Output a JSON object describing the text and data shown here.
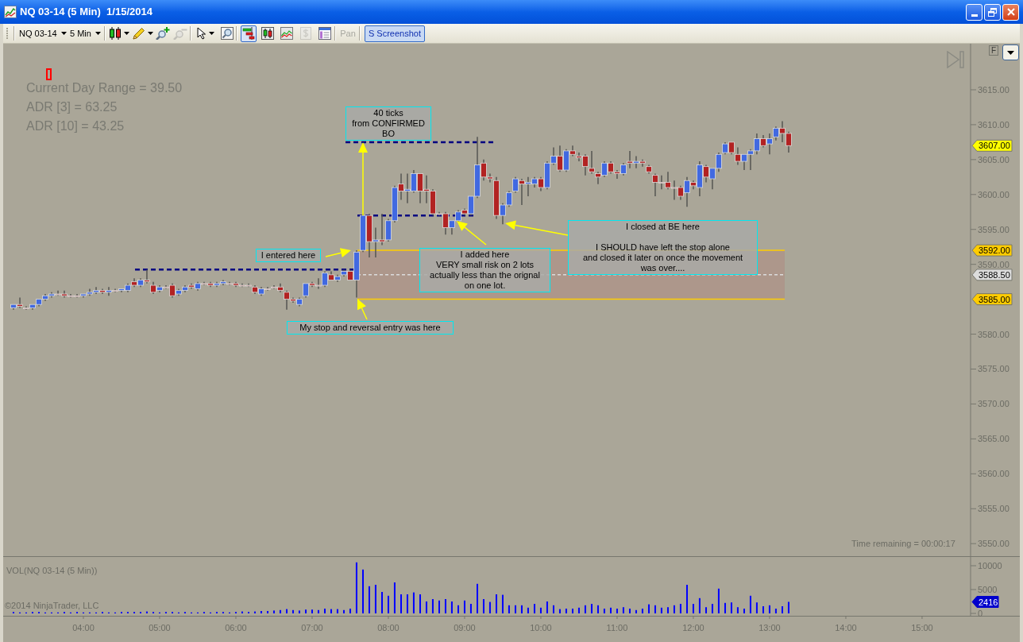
{
  "window": {
    "title": "NQ 03-14 (5 Min)  1/15/2014"
  },
  "toolbar": {
    "instrument": {
      "label": "NQ 03-14"
    },
    "interval": {
      "label": "5 Min"
    },
    "tools": [
      {
        "dropdown": true,
        "disabled": false
      },
      {
        "dropdown": true,
        "disabled": false
      },
      {
        "dropdown": false,
        "disabled": false
      },
      {
        "dropdown": false,
        "disabled": true
      },
      {
        "dropdown": true,
        "disabled": false
      },
      {
        "dropdown": false,
        "disabled": false
      }
    ],
    "toggles": [
      {
        "selected": true,
        "disabled": false
      },
      {
        "selected": false,
        "disabled": false
      },
      {
        "selected": false,
        "disabled": false
      },
      {
        "selected": false,
        "disabled": true
      },
      {
        "selected": false,
        "disabled": false
      }
    ],
    "pan": {
      "label": "Pan",
      "disabled": true
    },
    "screenshot": {
      "label": "S Screenshot",
      "selected": true
    }
  },
  "price_pane": {
    "indicator_lines": [
      "Current Day Range = 39.50",
      "ADR [3] = 63.25",
      "ADR [10] = 43.25"
    ],
    "f_button": {
      "label": "F"
    },
    "axis_tags": [
      {
        "label": "3607.00"
      },
      {
        "label": "3592.00"
      },
      {
        "label": "3588.50"
      },
      {
        "label": "3585.00"
      }
    ],
    "time_remaining": "Time remaining = 00:00:17",
    "chart_data": [
      {
        "type": "candlestick",
        "tick_labels": "y",
        "xlim": [
          2.948,
          16.282
        ],
        "ylim": [
          3548.2,
          3621.6
        ],
        "yticks": [
          {
            "value": 3550,
            "label": "3550.00"
          },
          {
            "value": 3555,
            "label": "3555.00"
          },
          {
            "value": 3560,
            "label": "3560.00"
          },
          {
            "value": 3565,
            "label": "3565.00"
          },
          {
            "value": 3570,
            "label": "3570.00"
          },
          {
            "value": 3575,
            "label": "3575.00"
          },
          {
            "value": 3580,
            "label": "3580.00"
          },
          {
            "value": 3590,
            "label": "3590.00"
          },
          {
            "value": 3595,
            "label": "3595.00"
          },
          {
            "value": 3600,
            "label": "3600.00"
          },
          {
            "value": 3605,
            "label": "3605.00"
          },
          {
            "value": 3610,
            "label": "3610.00"
          },
          {
            "value": 3615,
            "label": "3615.00"
          }
        ],
        "x": [
          3.083,
          3.167,
          3.25,
          3.333,
          3.417,
          3.5,
          3.583,
          3.667,
          3.75,
          3.833,
          3.917,
          4,
          4.083,
          4.167,
          4.25,
          4.333,
          4.417,
          4.5,
          4.583,
          4.667,
          4.75,
          4.833,
          4.917,
          5,
          5.083,
          5.167,
          5.25,
          5.333,
          5.417,
          5.5,
          5.583,
          5.667,
          5.75,
          5.833,
          5.917,
          6,
          6.083,
          6.167,
          6.25,
          6.333,
          6.417,
          6.5,
          6.583,
          6.667,
          6.75,
          6.833,
          6.917,
          7,
          7.083,
          7.167,
          7.25,
          7.333,
          7.417,
          7.5,
          7.583,
          7.667,
          7.75,
          7.833,
          7.917,
          8,
          8.083,
          8.167,
          8.25,
          8.333,
          8.417,
          8.5,
          8.583,
          8.667,
          8.75,
          8.833,
          8.917,
          9,
          9.083,
          9.167,
          9.25,
          9.333,
          9.417,
          9.5,
          9.583,
          9.667,
          9.75,
          9.833,
          9.917,
          10,
          10.083,
          10.167,
          10.25,
          10.333,
          10.417,
          10.5,
          10.583,
          10.667,
          10.75,
          10.833,
          10.917,
          11,
          11.083,
          11.167,
          11.25,
          11.333,
          11.417,
          11.5,
          11.583,
          11.667,
          11.75,
          11.833,
          11.917,
          12,
          12.083,
          12.167,
          12.25,
          12.333,
          12.417,
          12.5,
          12.583,
          12.667,
          12.75,
          12.833,
          12.917,
          13,
          13.083,
          13.167,
          13.25
        ],
        "ohlc": [
          [
            3583.75,
            3584.25,
            3583.5,
            3584.25
          ],
          [
            3584.25,
            3585.25,
            3583.75,
            3584
          ],
          [
            3583.75,
            3584,
            3583.5,
            3583.75
          ],
          [
            3583.75,
            3584.25,
            3583.5,
            3584.25
          ],
          [
            3584.25,
            3585,
            3584,
            3585
          ],
          [
            3585,
            3585.75,
            3584.75,
            3585.5
          ],
          [
            3585.5,
            3586,
            3585.25,
            3585.75
          ],
          [
            3585.75,
            3586.25,
            3585.5,
            3585.75
          ],
          [
            3585.75,
            3586.25,
            3585.25,
            3585.5
          ],
          [
            3585.5,
            3585.75,
            3585.25,
            3585.5
          ],
          [
            3585.5,
            3585.75,
            3585.25,
            3585.5
          ],
          [
            3585.5,
            3585.75,
            3585.25,
            3585.75
          ],
          [
            3585.75,
            3586.5,
            3585.5,
            3586
          ],
          [
            3586,
            3586.75,
            3585.75,
            3586.25
          ],
          [
            3586.25,
            3586.5,
            3585.75,
            3586
          ],
          [
            3586,
            3586.75,
            3585.5,
            3586.25
          ],
          [
            3586.25,
            3586.5,
            3586,
            3586.25
          ],
          [
            3586.25,
            3586.5,
            3586,
            3586.5
          ],
          [
            3586.25,
            3587.25,
            3586,
            3587
          ],
          [
            3587.5,
            3588,
            3586.75,
            3587
          ],
          [
            3587,
            3588,
            3586.75,
            3587.75
          ],
          [
            3587.75,
            3589.25,
            3587.25,
            3587.5
          ],
          [
            3587,
            3587.5,
            3585.75,
            3586
          ],
          [
            3586.25,
            3587,
            3586,
            3586.75
          ],
          [
            3586.75,
            3587,
            3586.5,
            3586.75
          ],
          [
            3587,
            3587.25,
            3585.25,
            3585.5
          ],
          [
            3585.75,
            3586.5,
            3585.5,
            3586.25
          ],
          [
            3586.25,
            3587,
            3586,
            3586.75
          ],
          [
            3587,
            3587.25,
            3586.5,
            3586.75
          ],
          [
            3586.5,
            3587.5,
            3586.25,
            3587.25
          ],
          [
            3587.25,
            3587.5,
            3587,
            3587.25
          ],
          [
            3587.25,
            3587.5,
            3586.75,
            3587
          ],
          [
            3587,
            3587.5,
            3586.75,
            3587.25
          ],
          [
            3587.25,
            3587.75,
            3587,
            3587.5
          ],
          [
            3587.25,
            3587.5,
            3587,
            3587.25
          ],
          [
            3587.25,
            3587.5,
            3586.75,
            3587
          ],
          [
            3587,
            3587.25,
            3586.75,
            3587
          ],
          [
            3587,
            3587.25,
            3586.75,
            3587
          ],
          [
            3586.75,
            3587,
            3585.75,
            3586
          ],
          [
            3585.75,
            3586.75,
            3585.5,
            3586.5
          ],
          [
            3586.5,
            3586.75,
            3586.25,
            3586.5
          ],
          [
            3586.75,
            3587,
            3586.5,
            3586.75
          ],
          [
            3586.75,
            3587.25,
            3586,
            3586.25
          ],
          [
            3586,
            3586.25,
            3583.5,
            3585
          ],
          [
            3585,
            3585.25,
            3584.5,
            3584.75
          ],
          [
            3584.25,
            3585.25,
            3584,
            3585
          ],
          [
            3585.5,
            3587.25,
            3585.25,
            3587.25
          ],
          [
            3587.25,
            3587.5,
            3586.75,
            3587
          ],
          [
            3587,
            3588,
            3586.5,
            3587
          ],
          [
            3587,
            3589,
            3586.75,
            3588.75
          ],
          [
            3588.5,
            3589,
            3587.75,
            3587.75
          ],
          [
            3587.75,
            3588.5,
            3587.5,
            3588.25
          ],
          [
            3588.5,
            3589.25,
            3588.25,
            3589
          ],
          [
            3589,
            3589.25,
            3587.75,
            3587.75
          ],
          [
            3587.75,
            3592,
            3585.25,
            3591.75
          ],
          [
            3592,
            3597.25,
            3591.75,
            3597
          ],
          [
            3597,
            3597.25,
            3591,
            3593.25
          ],
          [
            3593.25,
            3595.25,
            3591,
            3593.5
          ],
          [
            3593.5,
            3597.25,
            3592.75,
            3593.25
          ],
          [
            3593.5,
            3596.5,
            3593.25,
            3596.25
          ],
          [
            3596.25,
            3601.25,
            3596,
            3601
          ],
          [
            3601.5,
            3603,
            3599.25,
            3600.5
          ],
          [
            3600.5,
            3603,
            3598.75,
            3600.75
          ],
          [
            3600.5,
            3603.5,
            3600.25,
            3603
          ],
          [
            3603,
            3603,
            3598.75,
            3600.5
          ],
          [
            3600.75,
            3602.75,
            3598.75,
            3600.5
          ],
          [
            3600.5,
            3600.75,
            3597,
            3597.25
          ],
          [
            3597.25,
            3597.5,
            3597,
            3597.25
          ],
          [
            3597.25,
            3597.5,
            3594.25,
            3595.25
          ],
          [
            3595.25,
            3596.25,
            3594.25,
            3596.25
          ],
          [
            3596.25,
            3597.75,
            3596,
            3597.5
          ],
          [
            3597.75,
            3598,
            3597,
            3597.25
          ],
          [
            3597.25,
            3599.75,
            3597,
            3599.75
          ],
          [
            3599.75,
            3608.25,
            3599.5,
            3604.25
          ],
          [
            3604.5,
            3605,
            3602,
            3602.5
          ],
          [
            3602.5,
            3603,
            3601.75,
            3602.25
          ],
          [
            3602,
            3602.5,
            3596.5,
            3597
          ],
          [
            3597,
            3598.75,
            3595.75,
            3598.5
          ],
          [
            3598.5,
            3600.5,
            3598.25,
            3600.25
          ],
          [
            3600.5,
            3602.5,
            3600.25,
            3602.25
          ],
          [
            3602,
            3602.25,
            3598.5,
            3601.5
          ],
          [
            3601.5,
            3602.5,
            3599.75,
            3601.75
          ],
          [
            3601.5,
            3602.5,
            3601,
            3602.25
          ],
          [
            3602.25,
            3602.5,
            3600.5,
            3601
          ],
          [
            3601,
            3604.75,
            3600.75,
            3604.5
          ],
          [
            3604.5,
            3606.75,
            3604.25,
            3605.5
          ],
          [
            3605.5,
            3607,
            3603.25,
            3603.5
          ],
          [
            3603.5,
            3606.5,
            3603.25,
            3606.25
          ],
          [
            3606.25,
            3607,
            3605.5,
            3605.75
          ],
          [
            3605.5,
            3606,
            3604.75,
            3605.25
          ],
          [
            3605.5,
            3605.75,
            3602.75,
            3604
          ],
          [
            3603.75,
            3606.25,
            3603,
            3603.25
          ],
          [
            3603,
            3603.25,
            3601.5,
            3602.5
          ],
          [
            3602.75,
            3604.75,
            3602.5,
            3604.5
          ],
          [
            3604.5,
            3604.75,
            3603,
            3603.25
          ],
          [
            3603.25,
            3603.5,
            3602.25,
            3603
          ],
          [
            3603,
            3604.5,
            3602.75,
            3604.25
          ],
          [
            3604.75,
            3606.25,
            3603.75,
            3604.5
          ],
          [
            3604.5,
            3605.5,
            3603.75,
            3604.75
          ],
          [
            3604.75,
            3605,
            3604,
            3604.5
          ],
          [
            3604,
            3604.25,
            3603,
            3603.25
          ],
          [
            3602.75,
            3603,
            3599.75,
            3601.75
          ],
          [
            3601.75,
            3602.75,
            3600.75,
            3601.75
          ],
          [
            3601.75,
            3603.25,
            3600.75,
            3601
          ],
          [
            3601,
            3602,
            3599.25,
            3601
          ],
          [
            3601,
            3601.25,
            3599.25,
            3599.75
          ],
          [
            3600.25,
            3602.5,
            3598.25,
            3602
          ],
          [
            3601.75,
            3602,
            3600.75,
            3601.25
          ],
          [
            3601,
            3604.75,
            3599.75,
            3604.25
          ],
          [
            3604,
            3604.25,
            3601.75,
            3602.5
          ],
          [
            3602.25,
            3603.75,
            3600.75,
            3603.75
          ],
          [
            3603.75,
            3606,
            3603.25,
            3605.75
          ],
          [
            3606,
            3607.5,
            3605.75,
            3607.25
          ],
          [
            3607.5,
            3607.5,
            3605.75,
            3606
          ],
          [
            3605.75,
            3606.75,
            3604.25,
            3604.75
          ],
          [
            3604.75,
            3605.75,
            3603.5,
            3605.75
          ],
          [
            3605.75,
            3606.5,
            3603.5,
            3606.25
          ],
          [
            3606.25,
            3608.75,
            3605.75,
            3608
          ],
          [
            3608,
            3608.5,
            3606.75,
            3607
          ],
          [
            3607.25,
            3608.75,
            3605.75,
            3608
          ],
          [
            3608.25,
            3609.75,
            3607.75,
            3609.5
          ],
          [
            3609.5,
            3610.5,
            3607.5,
            3608.75
          ],
          [
            3608.75,
            3609,
            3606,
            3607
          ]
        ],
        "ref_lines": [
          {
            "axis": "y",
            "value": 3589.25,
            "color": "#000080",
            "line_style": "dashed"
          },
          {
            "axis": "y",
            "value": 3607.5,
            "color": "#000080",
            "line_style": "dashed"
          },
          {
            "axis": "y",
            "value": 3597,
            "color": "#000080",
            "line_style": "dashed"
          },
          {
            "axis": "y",
            "value": 3592,
            "color": "#ffcc00",
            "line_style": "solid"
          },
          {
            "axis": "y",
            "value": 3588.5,
            "color": "#dcdcdc",
            "line_style": "dashed"
          },
          {
            "axis": "y",
            "value": 3585,
            "color": "#ffcc00",
            "line_style": "solid"
          }
        ],
        "bands": [
          {
            "axis": "y",
            "from": 3585,
            "to": 3592,
            "color": "#ad978b"
          }
        ],
        "annotations": [
          "40 ticks\nfrom CONFIRMED\nBO",
          "I closed at BE here\n\nI SHOULD have left the stop alone\nand closed it later on once the movement\nwas over....",
          "I entered here",
          "I added here\nVERY small risk on 2 lots\nactually less than the orignal\non one lot.",
          "My stop and reversal entry was here"
        ]
      }
    ]
  },
  "volume_pane": {
    "copyright": "©2014 NinjaTrader, LLC",
    "axis_tags": [
      {
        "label": "2416"
      }
    ],
    "chart_data": [
      {
        "type": "bar",
        "title": "VOL(NQ 03-14 (5 Min))",
        "color": "#0000ff",
        "xlim": [
          2.948,
          16.282
        ],
        "ylim": [
          -500,
          12000
        ],
        "yticks": [
          {
            "value": 0,
            "label": "0"
          },
          {
            "value": 5000,
            "label": "5000"
          },
          {
            "value": 10000,
            "label": "10000"
          }
        ],
        "xticks": [
          {
            "value": 4,
            "label": "04:00"
          },
          {
            "value": 5,
            "label": "05:00"
          },
          {
            "value": 6,
            "label": "06:00"
          },
          {
            "value": 7,
            "label": "07:00"
          },
          {
            "value": 8,
            "label": "08:00"
          },
          {
            "value": 9,
            "label": "09:00"
          },
          {
            "value": 10,
            "label": "10:00"
          },
          {
            "value": 11,
            "label": "11:00"
          },
          {
            "value": 12,
            "label": "12:00"
          },
          {
            "value": 13,
            "label": "13:00"
          },
          {
            "value": 14,
            "label": "14:00"
          },
          {
            "value": 15,
            "label": "15:00"
          }
        ],
        "x": [
          3.083,
          3.167,
          3.25,
          3.333,
          3.417,
          3.5,
          3.583,
          3.667,
          3.75,
          3.833,
          3.917,
          4,
          4.083,
          4.167,
          4.25,
          4.333,
          4.417,
          4.5,
          4.583,
          4.667,
          4.75,
          4.833,
          4.917,
          5,
          5.083,
          5.167,
          5.25,
          5.333,
          5.417,
          5.5,
          5.583,
          5.667,
          5.75,
          5.833,
          5.917,
          6,
          6.083,
          6.167,
          6.25,
          6.333,
          6.417,
          6.5,
          6.583,
          6.667,
          6.75,
          6.833,
          6.917,
          7,
          7.083,
          7.167,
          7.25,
          7.333,
          7.417,
          7.5,
          7.583,
          7.667,
          7.75,
          7.833,
          7.917,
          8,
          8.083,
          8.167,
          8.25,
          8.333,
          8.417,
          8.5,
          8.583,
          8.667,
          8.75,
          8.833,
          8.917,
          9,
          9.083,
          9.167,
          9.25,
          9.333,
          9.417,
          9.5,
          9.583,
          9.667,
          9.75,
          9.833,
          9.917,
          10,
          10.083,
          10.167,
          10.25,
          10.333,
          10.417,
          10.5,
          10.583,
          10.667,
          10.75,
          10.833,
          10.917,
          11,
          11.083,
          11.167,
          11.25,
          11.333,
          11.417,
          11.5,
          11.583,
          11.667,
          11.75,
          11.833,
          11.917,
          12,
          12.083,
          12.167,
          12.25,
          12.333,
          12.417,
          12.5,
          12.583,
          12.667,
          12.75,
          12.833,
          12.917,
          13,
          13.083,
          13.167,
          13.25
        ],
        "values": [
          300,
          200,
          200,
          300,
          300,
          200,
          200,
          200,
          300,
          200,
          300,
          200,
          200,
          200,
          300,
          200,
          200,
          300,
          300,
          300,
          300,
          400,
          300,
          200,
          300,
          300,
          200,
          300,
          200,
          200,
          300,
          200,
          300,
          300,
          200,
          300,
          400,
          300,
          400,
          500,
          500,
          600,
          700,
          900,
          700,
          600,
          800,
          800,
          700,
          1000,
          900,
          900,
          700,
          1000,
          10700,
          9200,
          5700,
          6000,
          4500,
          3700,
          6500,
          4000,
          4000,
          4400,
          4000,
          2500,
          3000,
          2700,
          3000,
          2500,
          1700,
          2700,
          2000,
          6200,
          3000,
          2400,
          4000,
          3900,
          1700,
          1700,
          1700,
          1200,
          2000,
          1200,
          2500,
          1700,
          900,
          1000,
          1000,
          1200,
          1700,
          2000,
          1700,
          1000,
          1200,
          1000,
          1300,
          1000,
          700,
          1000,
          1900,
          1700,
          1200,
          1300,
          1700,
          2000,
          6000,
          2000,
          3200,
          1300,
          2000,
          5200,
          2200,
          2300,
          1300,
          1000,
          3700,
          2300,
          1500,
          1700,
          1000,
          1500,
          2416
        ]
      }
    ]
  }
}
